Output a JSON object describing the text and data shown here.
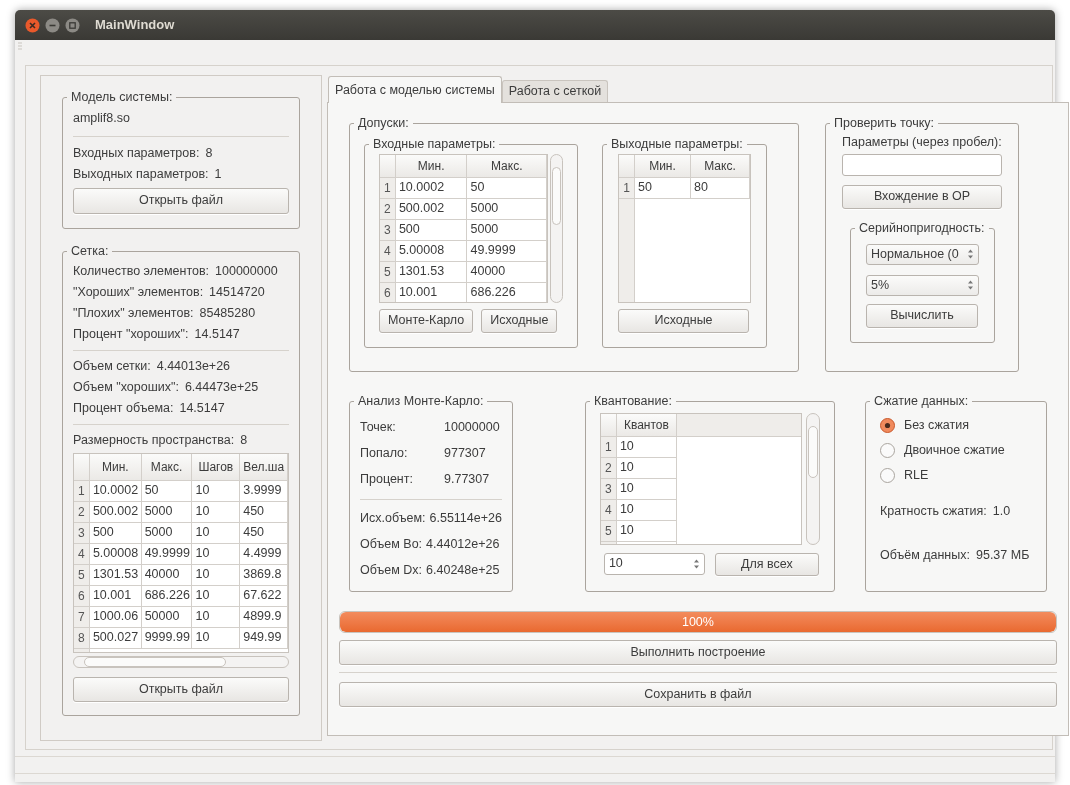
{
  "window": {
    "title": "MainWindow"
  },
  "model": {
    "title": "Модель системы:",
    "file": "amplif8.so",
    "stats": [
      {
        "label": "Входных параметров:",
        "value": "8"
      },
      {
        "label": "Выходных параметров:",
        "value": "1"
      }
    ],
    "button": "Открыть файл"
  },
  "grid": {
    "title": "Сетка:",
    "sections": [
      [
        {
          "label": "Количество элементов:",
          "value": "100000000"
        },
        {
          "label": "\"Хороших\" элементов:",
          "value": "14514720"
        },
        {
          "label": "\"Плохих\" элементов:",
          "value": "85485280"
        },
        {
          "label": "Процент \"хороших\":",
          "value": "14.5147"
        }
      ],
      [
        {
          "label": "Объем сетки:",
          "value": "4.44013e+26"
        },
        {
          "label": "Объем \"хороших\":",
          "value": "6.44473e+25"
        },
        {
          "label": "Процент объема:",
          "value": "14.5147"
        }
      ]
    ],
    "dimension": {
      "label": "Размерность пространства:",
      "value": "8"
    },
    "table": {
      "columns": [
        "Мин.",
        "Макс.",
        "Шагов",
        "Вел.ша"
      ],
      "rows": [
        {
          "index": "1",
          "cells": [
            "10.0002",
            "50",
            "10",
            "3.9999"
          ]
        },
        {
          "index": "2",
          "cells": [
            "500.002",
            "5000",
            "10",
            "450"
          ]
        },
        {
          "index": "3",
          "cells": [
            "500",
            "5000",
            "10",
            "450"
          ]
        },
        {
          "index": "4",
          "cells": [
            "5.00008",
            "49.9999",
            "10",
            "4.4999"
          ]
        },
        {
          "index": "5",
          "cells": [
            "1301.53",
            "40000",
            "10",
            "3869.8"
          ]
        },
        {
          "index": "6",
          "cells": [
            "10.001",
            "686.226",
            "10",
            "67.622"
          ]
        },
        {
          "index": "7",
          "cells": [
            "1000.06",
            "50000",
            "10",
            "4899.9"
          ]
        },
        {
          "index": "8",
          "cells": [
            "500.027",
            "9999.99",
            "10",
            "949.99"
          ]
        }
      ]
    },
    "button": "Открыть файл"
  },
  "tabs": [
    {
      "label": "Работа с моделью системы",
      "selected": true
    },
    {
      "label": "Работа с сеткой",
      "selected": false
    }
  ],
  "tolerances": {
    "title": "Допуски:",
    "inputs": {
      "title": "Входные параметры:",
      "columns": [
        "Мин.",
        "Макс."
      ],
      "rows": [
        {
          "index": "1",
          "cells": [
            "10.0002",
            "50"
          ]
        },
        {
          "index": "2",
          "cells": [
            "500.002",
            "5000"
          ]
        },
        {
          "index": "3",
          "cells": [
            "500",
            "5000"
          ]
        },
        {
          "index": "4",
          "cells": [
            "5.00008",
            "49.9999"
          ]
        },
        {
          "index": "5",
          "cells": [
            "1301.53",
            "40000"
          ]
        },
        {
          "index": "6",
          "cells": [
            "10.001",
            "686.226"
          ]
        }
      ],
      "buttons": [
        "Монте-Карло",
        "Исходные"
      ]
    },
    "outputs": {
      "title": "Выходные параметры:",
      "columns": [
        "Мин.",
        "Макс."
      ],
      "rows": [
        {
          "index": "1",
          "cells": [
            "50",
            "80"
          ]
        }
      ],
      "buttons": [
        "Исходные"
      ]
    }
  },
  "check_point": {
    "title": "Проверить точку:",
    "field_label": "Параметры (через пробел):",
    "button": "Вхождение в ОР",
    "serial": {
      "title": "Серийнопригодность:",
      "spinboxes": [
        "Нормальное (0",
        "5%"
      ],
      "button": "Вычислить"
    }
  },
  "monte_carlo": {
    "title": "Анализ Монте-Карло:",
    "sections": [
      [
        {
          "label": "Точек:",
          "value": "10000000"
        },
        {
          "label": "Попало:",
          "value": "977307"
        },
        {
          "label": "Процент:",
          "value": "9.77307"
        }
      ],
      [
        {
          "label": "Исх.объем:",
          "value": "6.55114e+26"
        },
        {
          "label": "Объем Bo:",
          "value": "4.44012e+26"
        },
        {
          "label": "Объем Dx:",
          "value": "6.40248e+25"
        }
      ]
    ]
  },
  "quantization": {
    "title": "Квантование:",
    "column": "Квантов",
    "rows": [
      {
        "index": "1",
        "value": "10"
      },
      {
        "index": "2",
        "value": "10"
      },
      {
        "index": "3",
        "value": "10"
      },
      {
        "index": "4",
        "value": "10"
      },
      {
        "index": "5",
        "value": "10"
      }
    ],
    "spinbox": "10",
    "button": "Для всех"
  },
  "compression": {
    "title": "Сжатие данных:",
    "options": [
      {
        "label": "Без сжатия",
        "selected": true
      },
      {
        "label": "Двоичное сжатие",
        "selected": false
      },
      {
        "label": "RLE",
        "selected": false
      }
    ],
    "ratio": {
      "label": "Кратность сжатия:",
      "value": "1.0"
    },
    "size": {
      "label": "Объём данных:",
      "value": "95.37 МБ"
    }
  },
  "progress": {
    "level": 1,
    "text": "100%"
  },
  "buttons": [
    "Выполнить построение",
    "Сохранить в файл"
  ]
}
